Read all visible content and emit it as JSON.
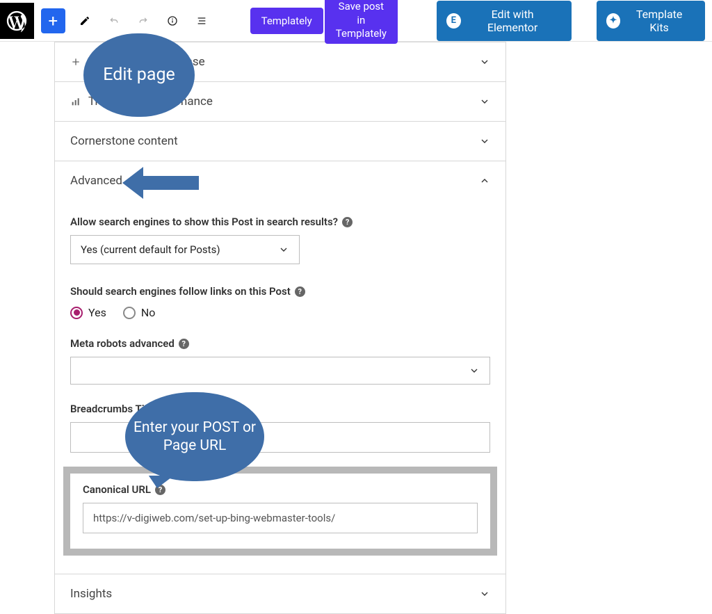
{
  "toolbar": {
    "templately": "Templately",
    "save_templately": "Save post in Templately",
    "edit_elementor": "Edit with Elementor",
    "template_kits": "Template Kits"
  },
  "sections": {
    "keyphrase": {
      "title": "Add related keyphrase"
    },
    "track": {
      "title": "Track SEO performance"
    },
    "cornerstone": {
      "title": "Cornerstone content"
    },
    "advanced": {
      "title": "Advanced"
    },
    "insights": {
      "title": "Insights"
    }
  },
  "advanced": {
    "allow_label": "Allow search engines to show this Post in search results?",
    "allow_value": "Yes (current default for Posts)",
    "follow_label": "Should search engines follow links on this Post",
    "follow_yes": "Yes",
    "follow_no": "No",
    "meta_robots_label": "Meta robots advanced",
    "breadcrumbs_label": "Breadcrumbs Title",
    "canonical_label": "Canonical URL",
    "canonical_value": "https://v-digiweb.com/set-up-bing-webmaster-tools/"
  },
  "callouts": {
    "edit_page": "Edit page",
    "enter_url": "Enter your POST or Page URL"
  }
}
